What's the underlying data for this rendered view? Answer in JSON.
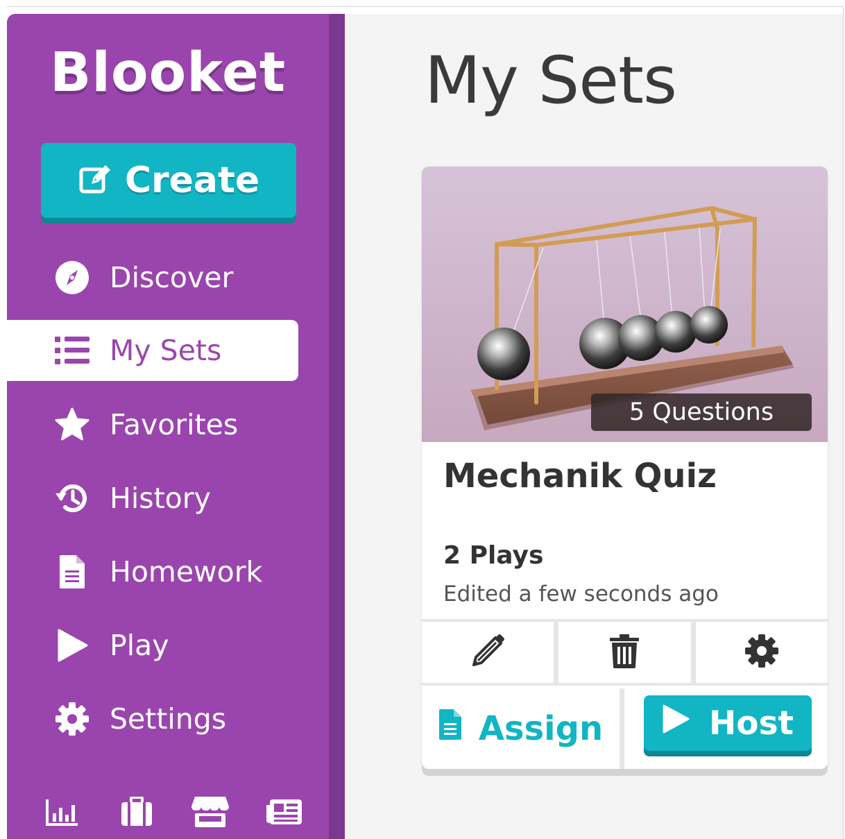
{
  "brand": {
    "logo_text": "Blooket",
    "accent": "#9a45ad",
    "teal": "#11b5c4"
  },
  "sidebar": {
    "create_label": "Create",
    "items": [
      {
        "label": "Discover",
        "icon": "compass-icon"
      },
      {
        "label": "My Sets",
        "icon": "list-icon",
        "active": true
      },
      {
        "label": "Favorites",
        "icon": "star-icon"
      },
      {
        "label": "History",
        "icon": "history-icon"
      },
      {
        "label": "Homework",
        "icon": "document-icon"
      },
      {
        "label": "Play",
        "icon": "play-icon"
      },
      {
        "label": "Settings",
        "icon": "gear-icon"
      }
    ],
    "bottom_icons": [
      "stats-icon",
      "briefcase-icon",
      "store-icon",
      "news-icon"
    ]
  },
  "main": {
    "title": "My Sets",
    "set_card": {
      "title": "Mechanik Quiz",
      "questions": "5 Questions",
      "plays": "2 Plays",
      "edited": "Edited a few seconds ago",
      "assign_label": "Assign",
      "host_label": "Host"
    }
  }
}
